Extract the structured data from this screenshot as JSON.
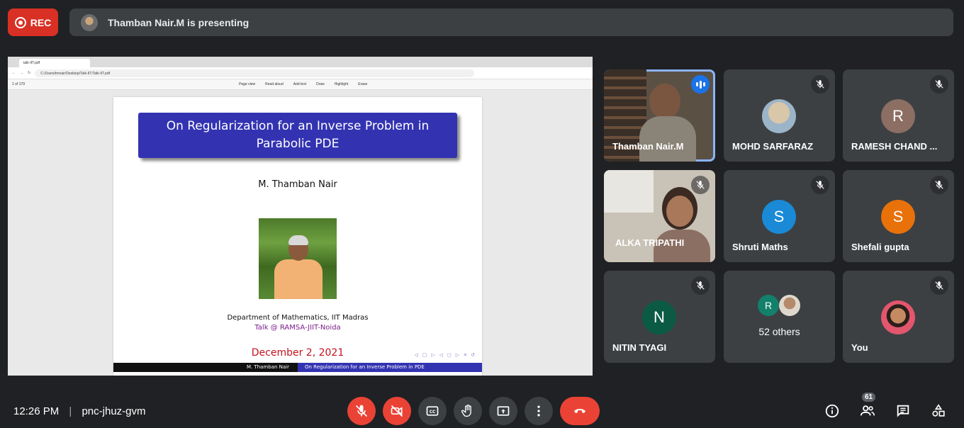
{
  "recording": {
    "label": "REC"
  },
  "presenter_banner": {
    "text": "Thamban Nair.M is presenting"
  },
  "browser": {
    "tab_title": "talk-IIT.pdf",
    "url": "C:/Users/tmnair/Desktop/Talk-IIT/Talk-IIT.pdf",
    "page_indicator": "1 of 179",
    "tools": [
      "Page view",
      "Read aloud",
      "Add text",
      "Draw",
      "Highlight",
      "Erase"
    ]
  },
  "slide": {
    "title": "On Regularization for an Inverse Problem in Parabolic PDE",
    "author": "M. Thamban Nair",
    "department": "Department of Mathematics, IIT Madras",
    "talk": "Talk @ RAMSA-JIIT-Noida",
    "date": "December 2, 2021",
    "footer_left": "M. Thamban Nair",
    "footer_right": "On Regularization for an Inverse Problem in PDE"
  },
  "participants": [
    {
      "name": "Thamban Nair.M"
    },
    {
      "name": "MOHD SARFARAZ"
    },
    {
      "name": "RAMESH CHAND ...",
      "initial": "R"
    },
    {
      "name": "ALKA TRIPATHI"
    },
    {
      "name": "Shruti Maths",
      "initial": "S"
    },
    {
      "name": "Shefali gupta",
      "initial": "S"
    },
    {
      "name": "NITIN TYAGI",
      "initial": "N"
    },
    {
      "name": "52 others",
      "initial": "R"
    },
    {
      "name": "You"
    }
  ],
  "colors": {
    "avatar_ramesh": "#8d6e63",
    "avatar_shruti": "#1a8ad6",
    "avatar_shefali": "#e8710a",
    "avatar_nitin": "#0b5b44",
    "avatar_others_r": "#12806a"
  },
  "bottom": {
    "time": "12:26 PM",
    "meeting_code": "pnc-jhuz-gvm",
    "people_count": "61"
  }
}
